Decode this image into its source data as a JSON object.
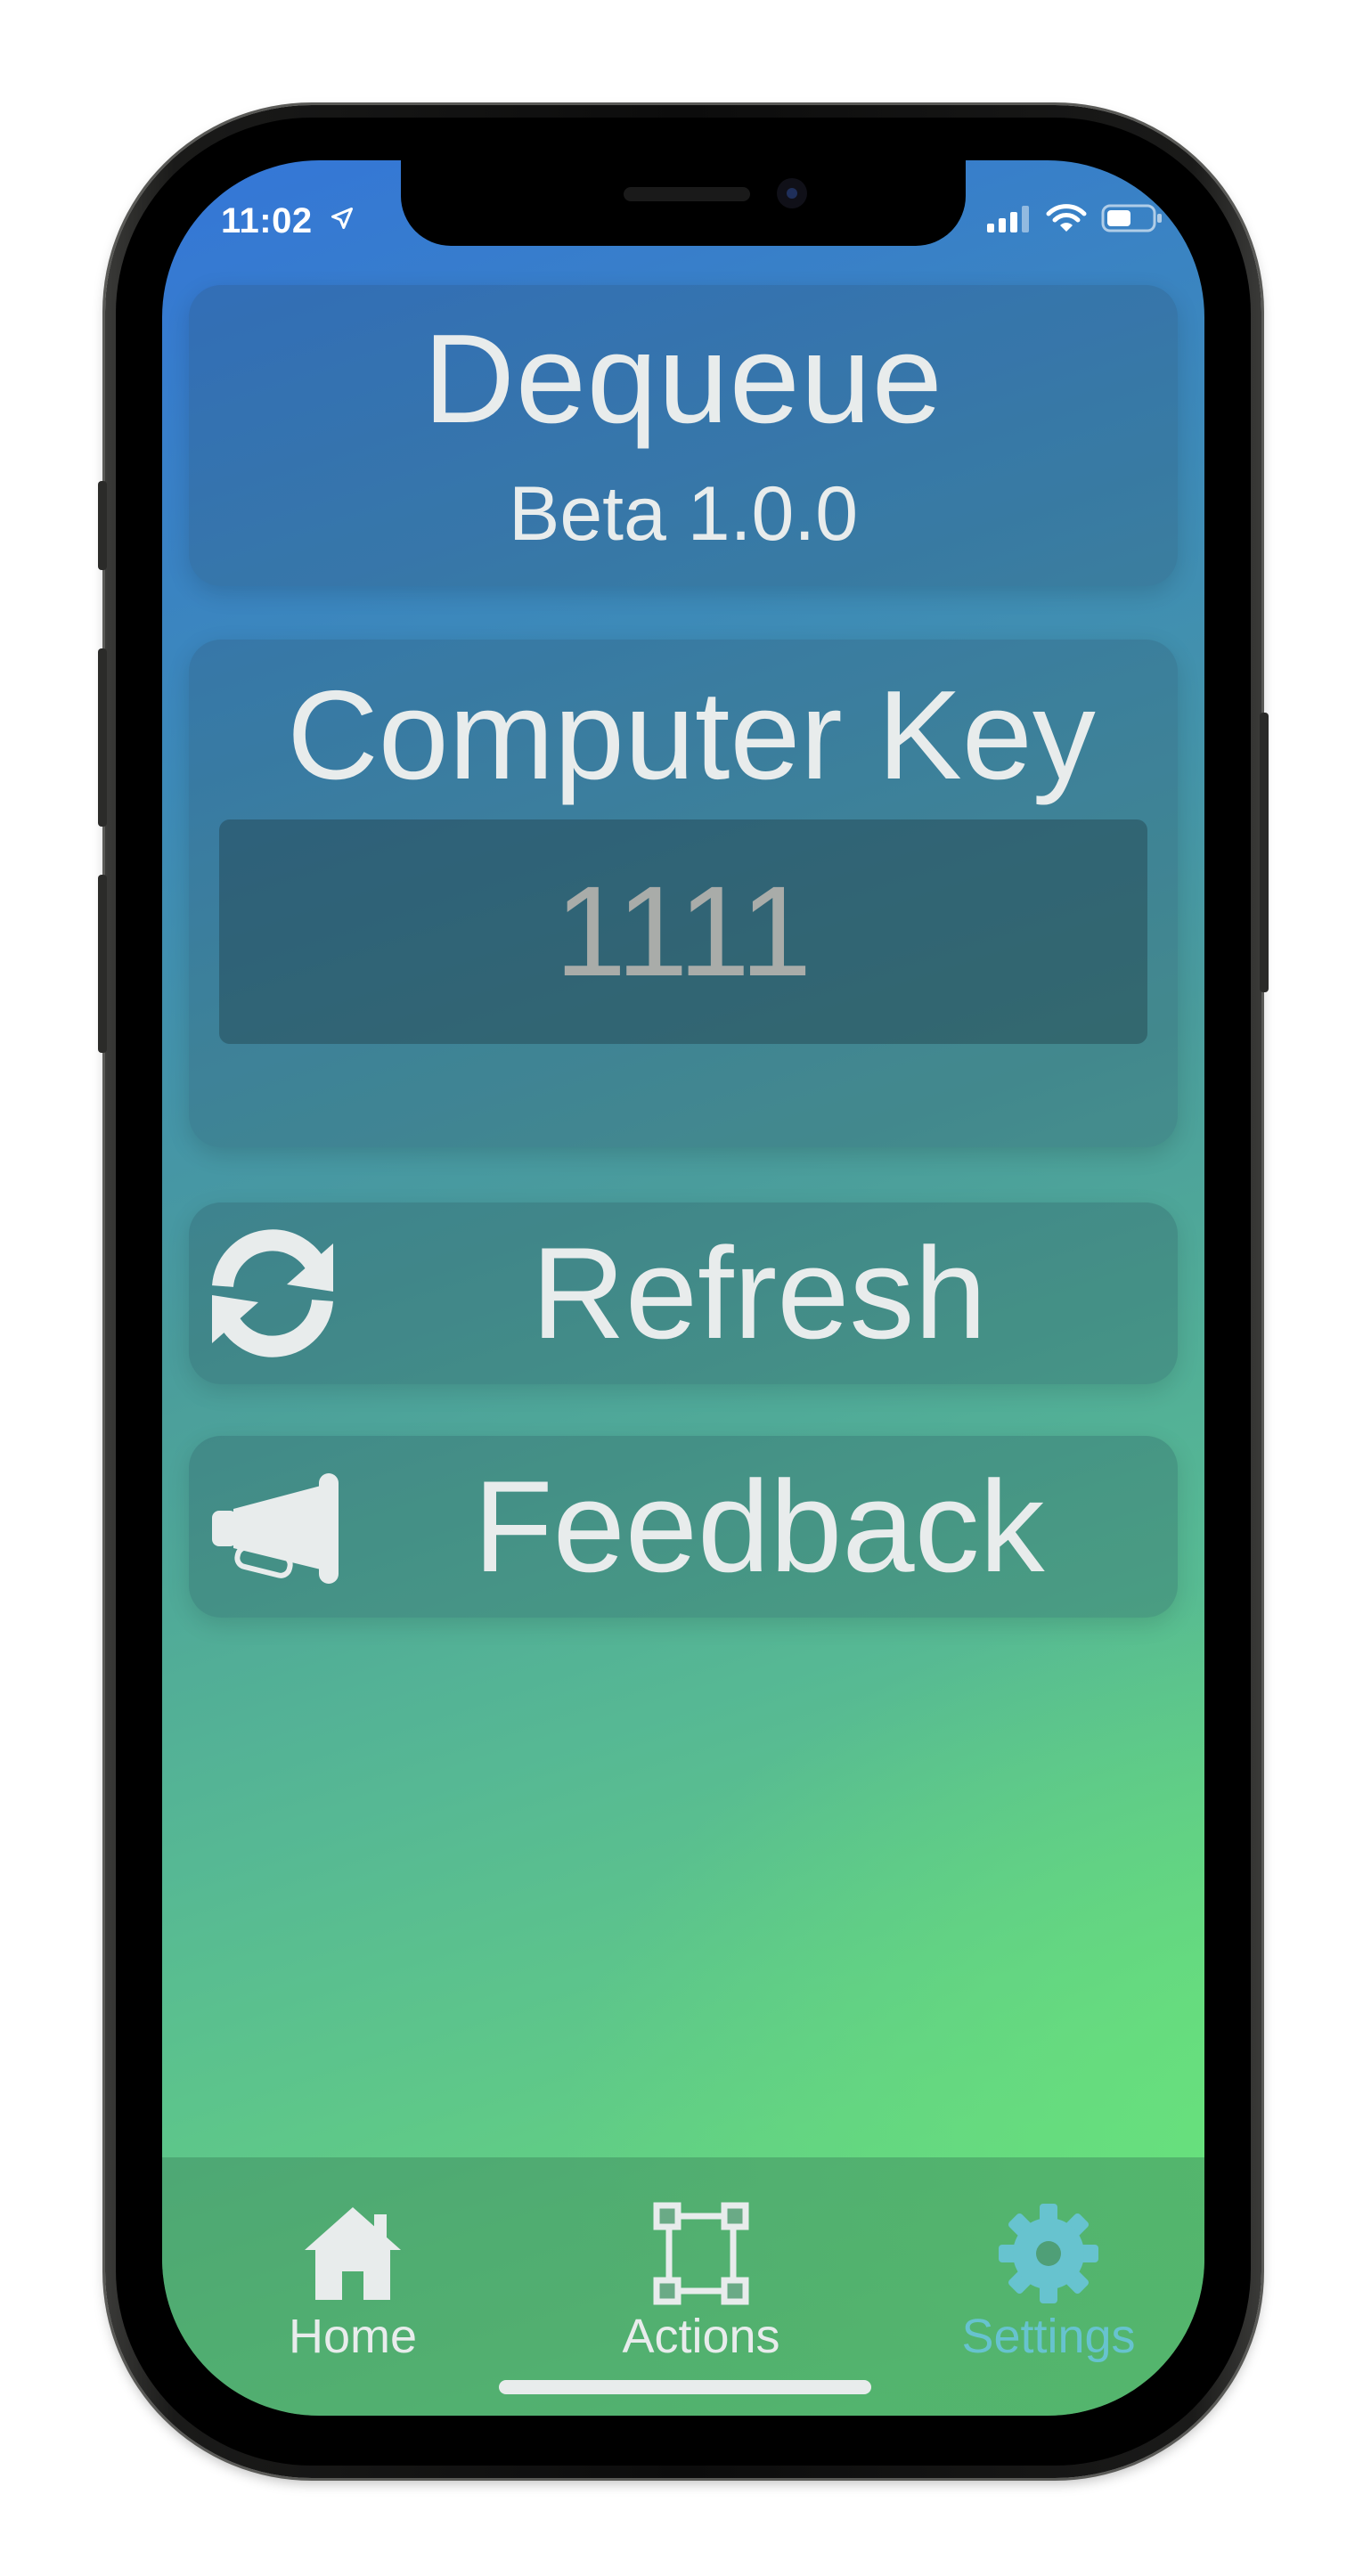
{
  "status_bar": {
    "time": "11:02",
    "location_icon": "location-arrow-icon",
    "signal_icon": "cellular-signal-icon",
    "wifi_icon": "wifi-icon",
    "battery_icon": "battery-icon"
  },
  "header": {
    "title": "Dequeue",
    "version": "Beta 1.0.0"
  },
  "computer_key": {
    "label": "Computer Key",
    "value": "1111"
  },
  "buttons": {
    "refresh": {
      "label": "Refresh",
      "icon": "refresh-icon"
    },
    "feedback": {
      "label": "Feedback",
      "icon": "megaphone-icon"
    }
  },
  "tabs": [
    {
      "label": "Home",
      "icon": "house-icon",
      "active": false
    },
    {
      "label": "Actions",
      "icon": "bounding-box-icon",
      "active": false
    },
    {
      "label": "Settings",
      "icon": "gear-icon",
      "active": true
    }
  ],
  "colors": {
    "text": "#e8ecec",
    "active_tab": "#67c3cf",
    "gradient_top": "#3476d8",
    "gradient_bottom": "#68de7c"
  }
}
